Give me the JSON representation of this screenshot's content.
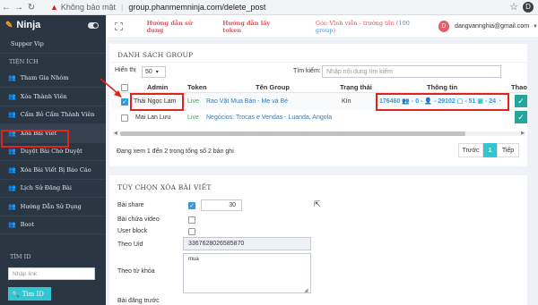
{
  "browser": {
    "security_label": "Không bảo mật",
    "url": "group.phanmemninja.com/delete_post",
    "profile_initial": "D"
  },
  "sidebar": {
    "brand": "Ninja",
    "top_item": "Supper Vip",
    "section": "TIỆN ÍCH",
    "items": [
      "Tham Gia Nhóm",
      "Xóa Thành Viên",
      "Cấm Bỏ Cấm Thành Viên",
      "Xóa Bài Viết",
      "Duyệt Bài Chờ Duyệt",
      "Xóa Bài Viết Bị Báo Cáo",
      "Lịch Sử Đăng Bài",
      "Hướng Dẫn Sử Dụng",
      "Boot"
    ],
    "find_id_label": "TÌM ID",
    "find_id_placeholder": "Nhập link",
    "find_id_button": "Tìm ID"
  },
  "header": {
    "link_guide": "Hướng dẫn sử dụng",
    "link_token": "Hướng dẫn lấy token",
    "plan_prefix": "Gói: Vĩnh viễn - trường tồn (",
    "plan_count": "100 group",
    "plan_suffix": ")",
    "user_initial": "D",
    "user_email": "dangvannghia@gmail.com"
  },
  "group_list": {
    "title": "DANH SÁCH GROUP",
    "show_label": "Hiển thị",
    "show_value": "50",
    "search_label": "Tìm kiếm:",
    "search_placeholder": "Nhập nội dung tìm kiếm",
    "columns": [
      "Admin",
      "Token",
      "Tên Group",
      "Trạng thái",
      "Thông tin",
      "Thao"
    ],
    "rows": [
      {
        "admin": "Thái Ngọc Lam",
        "token": "Live",
        "group_name": "Rao Vặt Mua Bán - Mẹ và Bé",
        "status": "Kín",
        "info": {
          "members": "176460",
          "a": "0",
          "b": "29102",
          "c": "51",
          "d": "24"
        },
        "checked": true
      },
      {
        "admin": "Mai Lan Lưu",
        "token": "Live",
        "group_name": "Negócios: Trocas e Vendas - Luanda, Angola",
        "status": "",
        "checked": false
      }
    ],
    "summary": "Đang xem 1 đến 2 trong tổng số 2 bản ghi",
    "pager": {
      "prev": "Trước",
      "current": "1",
      "next": "Tiếp"
    }
  },
  "options": {
    "title": "TÙY CHỌN XÓA BÀI VIẾT",
    "share_label": "Bài share",
    "share_value": "30",
    "video_label": "Bài chứa video",
    "user_block_label": "User block",
    "uid_label": "Theo Uid",
    "uid_value": "3367628026585870",
    "keyword_label": "Theo từ khóa",
    "keyword_value": "mua",
    "before_label": "Bài đăng trước"
  },
  "colors": {
    "sidebar": "#2b3643",
    "accent": "#32c5d2",
    "highlight": "#e2231a",
    "link_red": "#e7505a"
  }
}
